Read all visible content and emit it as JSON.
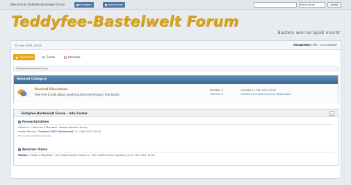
{
  "topbar": {
    "welcome": "Welcome to Teddyfee-Bastelwelt Forum",
    "login_label": "Einloggen",
    "register_label": "Registrieren",
    "search_select": "Entire forum",
    "search_submit": "Suche"
  },
  "header": {
    "logo": "Teddyfee-Bastelwelt Forum",
    "tagline": "Basteln weil es Spaß macht"
  },
  "userbar": {
    "date": "15. Mar 2023, 21:18",
    "right_label": "Neuigkeiten:",
    "right_value": "SMF - Just Installed!"
  },
  "menu": {
    "items": [
      {
        "label": "Übersicht",
        "icon": "home-icon"
      },
      {
        "label": "Suche",
        "icon": "search-icon"
      },
      {
        "label": "Kalender",
        "icon": "calendar-icon"
      }
    ]
  },
  "breadcrumb": "Teddyfee-Bastelwelt Forum",
  "category": {
    "title": "General Category",
    "forum": {
      "name": "General Discussion",
      "description": "Feel free to talk about anything and everything in this board.",
      "posts": "Beiträge: 4",
      "topics": "Themen: 2",
      "last_post_label": "Last post 11. Mar 2023, 20:13",
      "last_post_topic": "Creative 2023 (Dortmund) by Teddy Bastel"
    }
  },
  "info_center": {
    "title": "Teddyfee-Bastelwelt Forum - Info-Center",
    "stats_title": "Forumstatistiken",
    "stats_line1": "4 Posts in 2 Topics by 3 Members - Newest Member: Bucky",
    "stats_line2_prefix": "Letzter Beitrag: ",
    "stats_line2_topic": "\"Creative 2023 (Dortmund)\"",
    "stats_line2_suffix": " (11. Mar 2023, 20:13)",
    "stats_line3": "Die neuesten Beiträge anzeigen",
    "online_title": "Benutzer Online",
    "online_bold": "Online:",
    "online_line": " 1 Gäste, 0 Mitglieder - Am meisten online (heute): 2 - Am meisten online (gesamt): 4 (11. Mar 2023, 12:07)"
  },
  "colors": {
    "accent": "#e8a41a",
    "header_blue": "#4b78a6",
    "logo_gold": "#d9a51e",
    "link": "#3a6ea5"
  }
}
